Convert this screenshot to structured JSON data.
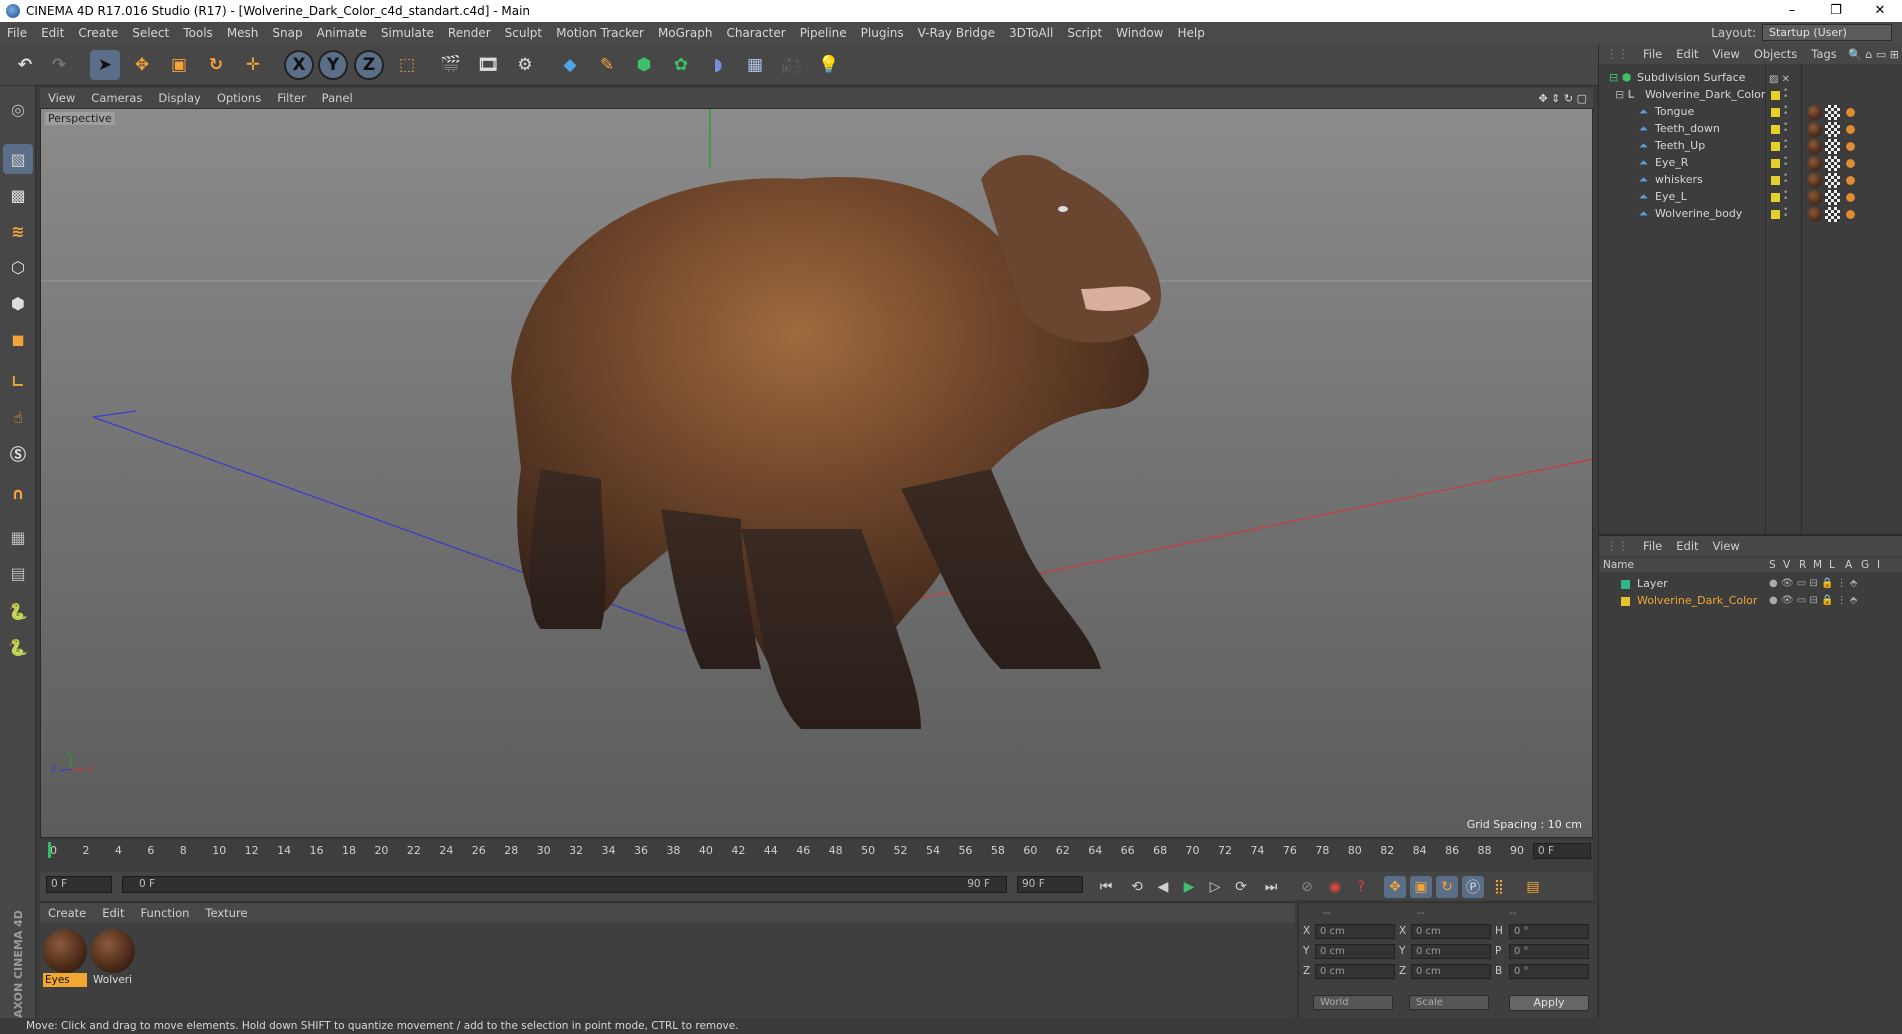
{
  "window": {
    "title": "CINEMA 4D R17.016 Studio (R17) - [Wolverine_Dark_Color_c4d_standart.c4d] - Main",
    "controls": [
      "–",
      "❐",
      "✕"
    ]
  },
  "menubar": {
    "items": [
      "File",
      "Edit",
      "Create",
      "Select",
      "Tools",
      "Mesh",
      "Snap",
      "Animate",
      "Simulate",
      "Render",
      "Sculpt",
      "Motion Tracker",
      "MoGraph",
      "Character",
      "Pipeline",
      "Plugins",
      "V-Ray Bridge",
      "3DToAll",
      "Script",
      "Window",
      "Help"
    ],
    "layout_label": "Layout:",
    "layout_value": "Startup (User)"
  },
  "toolbar": {
    "axis_x": "X",
    "axis_y": "Y",
    "axis_z": "Z"
  },
  "viewport": {
    "menu": [
      "View",
      "Cameras",
      "Display",
      "Options",
      "Filter",
      "Panel"
    ],
    "label": "Perspective",
    "grid_spacing": "Grid Spacing : 10 cm",
    "axis_y": "Y",
    "axis_z": "Z",
    "axis_x": "X"
  },
  "timeline": {
    "ticks": [
      "0",
      "2",
      "4",
      "6",
      "8",
      "10",
      "12",
      "14",
      "16",
      "18",
      "20",
      "22",
      "24",
      "26",
      "28",
      "30",
      "32",
      "34",
      "36",
      "38",
      "40",
      "42",
      "44",
      "46",
      "48",
      "50",
      "52",
      "54",
      "56",
      "58",
      "60",
      "62",
      "64",
      "66",
      "68",
      "70",
      "72",
      "74",
      "76",
      "78",
      "80",
      "82",
      "84",
      "86",
      "88",
      "90"
    ],
    "current_frame_right": "0 F",
    "start_field": "0 F",
    "range_start": "0 F",
    "range_end": "90 F",
    "end_field": "90 F"
  },
  "material_manager": {
    "menu": [
      "Create",
      "Edit",
      "Function",
      "Texture"
    ],
    "materials": [
      {
        "name": "Eyes",
        "selected": true
      },
      {
        "name": "Wolveri",
        "selected": false
      }
    ]
  },
  "coordinates": {
    "header": [
      "--",
      "--",
      "--"
    ],
    "rows": [
      {
        "a": "X",
        "av": "0 cm",
        "b": "X",
        "bv": "0 cm",
        "c": "H",
        "cv": "0 °"
      },
      {
        "a": "Y",
        "av": "0 cm",
        "b": "Y",
        "bv": "0 cm",
        "c": "P",
        "cv": "0 °"
      },
      {
        "a": "Z",
        "av": "0 cm",
        "b": "Z",
        "bv": "0 cm",
        "c": "B",
        "cv": "0 °"
      }
    ],
    "mode_world": "World",
    "mode_scale": "Scale",
    "apply": "Apply"
  },
  "status": "Move: Click and drag to move elements. Hold down SHIFT to quantize movement / add to the selection in point mode, CTRL to remove.",
  "maxon_logo": "MAXON CINEMA 4D",
  "object_manager": {
    "menu": [
      "File",
      "Edit",
      "View",
      "Objects",
      "Tags"
    ],
    "objects": [
      {
        "name": "Subdivision Surface",
        "indent": 0
      },
      {
        "name": "Wolverine_Dark_Color",
        "indent": 1
      },
      {
        "name": "Tongue",
        "indent": 2
      },
      {
        "name": "Teeth_down",
        "indent": 2
      },
      {
        "name": "Teeth_Up",
        "indent": 2
      },
      {
        "name": "Eye_R",
        "indent": 2
      },
      {
        "name": "whiskers",
        "indent": 2
      },
      {
        "name": "Eye_L",
        "indent": 2
      },
      {
        "name": "Wolverine_body",
        "indent": 2
      }
    ]
  },
  "layer_manager": {
    "menu": [
      "File",
      "Edit",
      "View"
    ],
    "columns": [
      "Name",
      "S",
      "V",
      "R",
      "M",
      "L",
      "A",
      "G",
      "I"
    ],
    "layers": [
      {
        "name": "Layer",
        "color": "#2fb68a",
        "highlight": false
      },
      {
        "name": "Wolverine_Dark_Color",
        "color": "#e6c42a",
        "highlight": true
      }
    ]
  },
  "colors": {
    "accent_blue": "#5a6f87",
    "highlight_orange": "#f0a830",
    "object_color": "#e6d12a"
  }
}
